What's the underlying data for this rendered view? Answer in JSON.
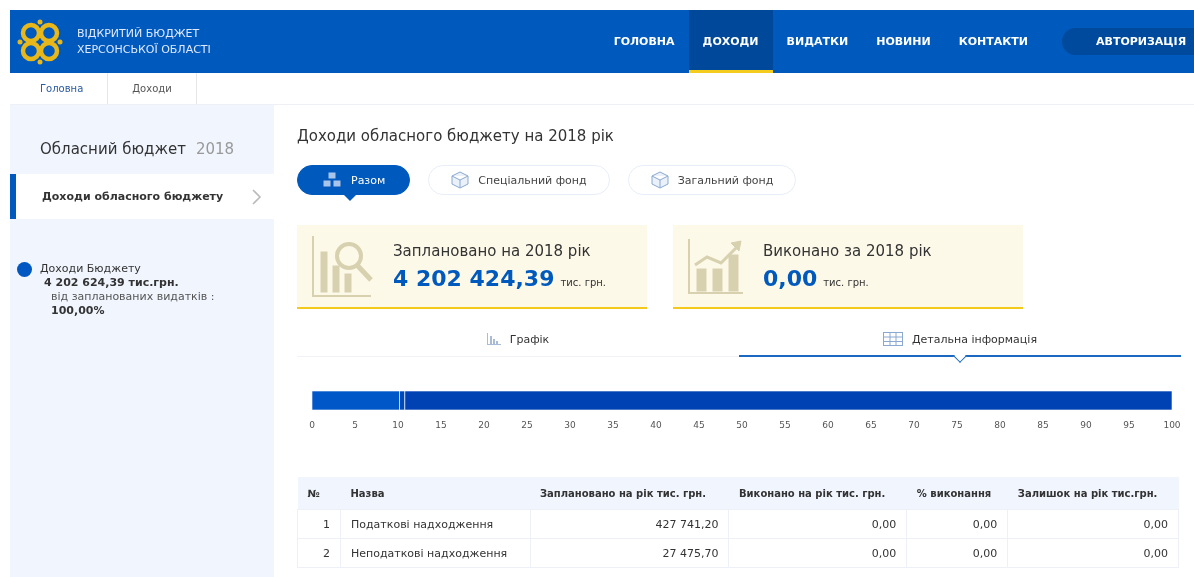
{
  "header": {
    "logo_line_1": "ВІДКРИТИЙ БЮДЖЕТ",
    "logo_line_2": "ХЕРСОНСЬКОЇ ОБЛАСТІ",
    "nav": [
      {
        "label": "ГОЛОВНА",
        "selected": false
      },
      {
        "label": "ДОХОДИ",
        "selected": true
      },
      {
        "label": "ВИДАТКИ",
        "selected": false
      },
      {
        "label": "НОВИНИ",
        "selected": false
      },
      {
        "label": "КОНТАКТИ",
        "selected": false
      }
    ],
    "login": "АВТОРИЗАЦІЯ"
  },
  "breadcrumbs": [
    "Головна",
    "Доходи"
  ],
  "sidebar": {
    "title": "Обласний бюджет",
    "year": "2018",
    "items": [
      {
        "label": "Доходи обласного бюджету",
        "selected": true
      }
    ],
    "legend": [
      {
        "color": "#0057c2",
        "name": "Доходи Бюджету",
        "amount": "4 202 624,39 тис.грн.",
        "note": "від запланованих видатків :",
        "percent": "100,00%"
      }
    ]
  },
  "main": {
    "title": "Доходи обласного бюджету на 2018 рік",
    "fund_tabs": [
      {
        "label": "Разом",
        "selected": true
      },
      {
        "label": "Спеціальний фонд",
        "selected": false
      },
      {
        "label": "Загальний фонд",
        "selected": false
      }
    ],
    "cards": [
      {
        "kind": "planned",
        "label": "Заплановано на 2018 рік",
        "value": "4 202 424,39",
        "unit": "тис. грн."
      },
      {
        "kind": "done",
        "label": "Виконано за 2018 рік",
        "value": "0,00",
        "unit": "тис. грн."
      }
    ],
    "view_tabs": [
      {
        "label": "Графік",
        "selected": false
      },
      {
        "label": "Детальна інформація",
        "selected": true
      }
    ],
    "chart_data": {
      "type": "bar",
      "orientation": "horizontal",
      "stacked": true,
      "series": [
        {
          "color": "#0058c8",
          "values": [
            10.2
          ]
        },
        {
          "color": "#0049b8",
          "values": [
            0.6
          ]
        },
        {
          "color": "#0041b4",
          "values": [
            89.2
          ]
        }
      ],
      "xlim": [
        0,
        100
      ],
      "xticks": [
        0,
        5,
        10,
        15,
        20,
        25,
        30,
        35,
        40,
        45,
        50,
        55,
        60,
        65,
        70,
        75,
        80,
        85,
        90,
        95,
        100
      ]
    },
    "table": {
      "columns": [
        "№",
        "Назва",
        "Заплановано на рік тис. грн.",
        "Виконано на рік тис. грн.",
        "% виконання",
        "Залишок на рік тис.грн."
      ],
      "rows": [
        [
          "1",
          "Податкові надходження",
          "427 741,20",
          "0,00",
          "0,00",
          "0,00"
        ],
        [
          "2",
          "Неподаткові надходження",
          "27 475,70",
          "0,00",
          "0,00",
          "0,00"
        ]
      ]
    }
  }
}
